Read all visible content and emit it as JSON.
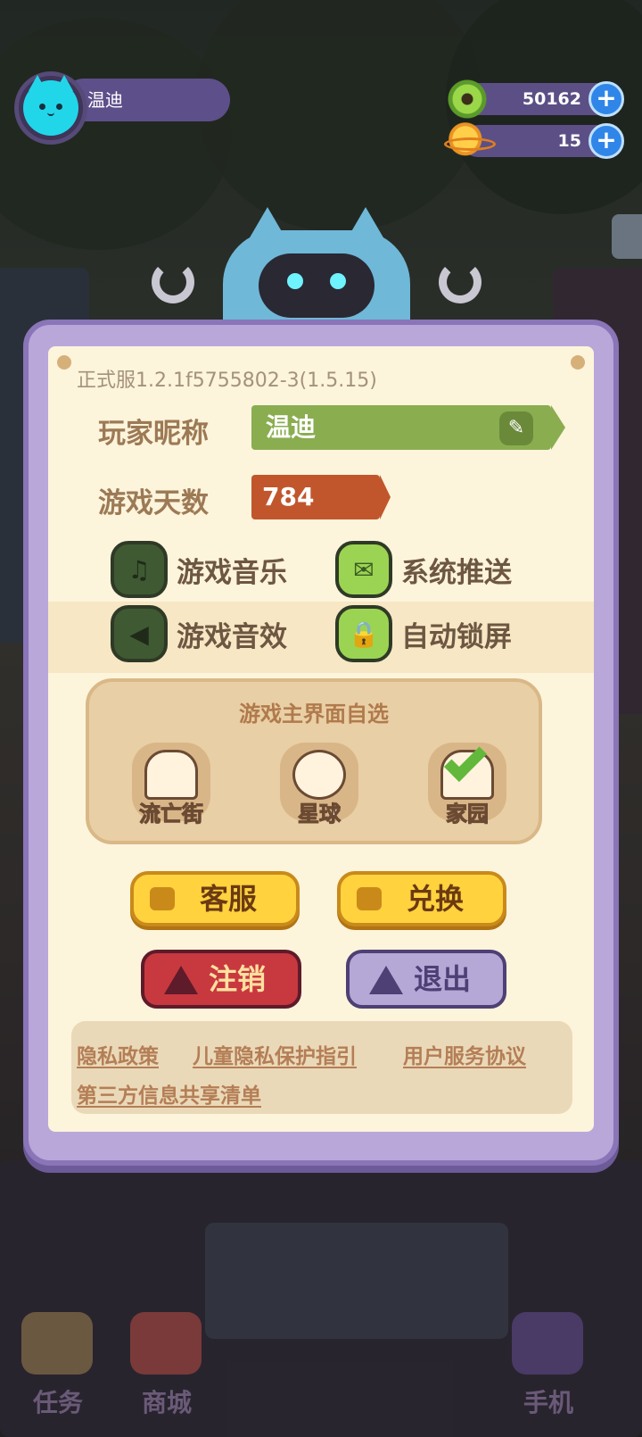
{
  "player": {
    "name": "温迪"
  },
  "resources": {
    "donut": "50162",
    "planet": "15"
  },
  "dialog": {
    "version": "正式服1.2.1f5755802-3(1.5.15)",
    "nickname_label": "玩家昵称",
    "nickname_value": "温迪",
    "days_label": "游戏天数",
    "days_value": "784",
    "toggles": {
      "music": "游戏音乐",
      "push": "系统推送",
      "sfx": "游戏音效",
      "lock": "自动锁屏"
    },
    "theme": {
      "title": "游戏主界面自选",
      "options": [
        "流亡街",
        "星球",
        "家园"
      ],
      "selected": "家园"
    },
    "buttons": {
      "service": "客服",
      "redeem": "兑换",
      "logout": "注销",
      "exit": "退出"
    },
    "links": [
      "隐私政策",
      "儿童隐私保护指引",
      "用户服务协议",
      "第三方信息共享清单"
    ]
  },
  "nav": {
    "tasks": "任务",
    "shop": "商城",
    "phone": "手机"
  },
  "colors": {
    "accent_green": "#8aad50",
    "days_orange": "#c1562c",
    "frame_purple": "#8a75b8",
    "logout_red": "#c8383f"
  }
}
